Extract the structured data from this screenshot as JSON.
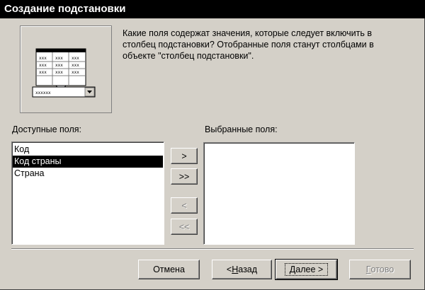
{
  "window": {
    "title": "Создание подстановки"
  },
  "description": "Какие поля содержат значения, которые следует включить в столбец подстановки? Отобранные поля станут столбцами в объекте \"столбец подстановки\".",
  "available": {
    "label": "Доступные поля:",
    "items": [
      "Код",
      "Код страны",
      "Страна"
    ],
    "selected_index": 1
  },
  "selected_fields": {
    "label": "Выбранные поля:",
    "items": []
  },
  "move_buttons": {
    "add_one": ">",
    "add_all": ">>",
    "remove_one": "<",
    "remove_all": "<<"
  },
  "footer": {
    "cancel": "Отмена",
    "back_prefix": "< ",
    "back_mnemonic": "Н",
    "back_rest": "азад",
    "next_mnemonic": "Д",
    "next_rest": "алее >",
    "finish_mnemonic": "Г",
    "finish_rest": "отово"
  },
  "illustration": {
    "grid_glyph": "xxx",
    "combo_glyph": "xxxxxx"
  }
}
